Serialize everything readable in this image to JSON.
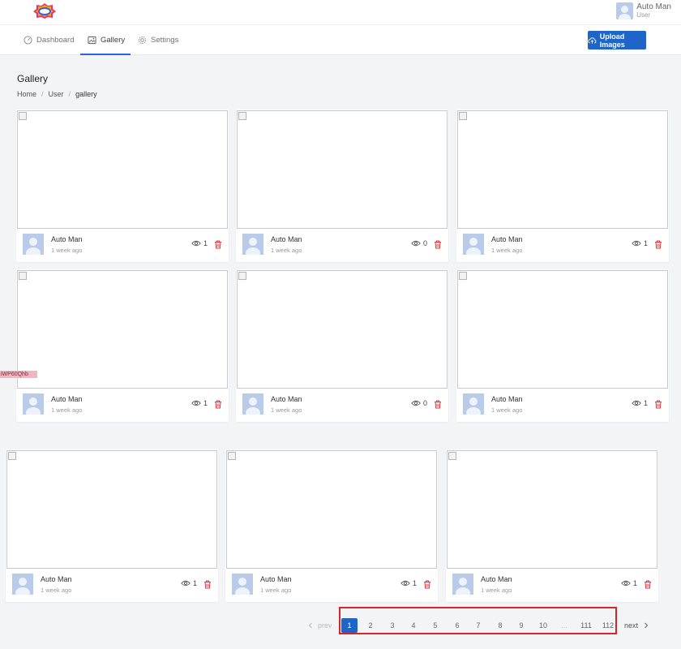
{
  "header": {
    "logo_name": "app-logo",
    "user": {
      "name": "Auto Man",
      "role": "User"
    }
  },
  "nav": {
    "tabs": [
      {
        "label": "Dashboard",
        "icon": "dashboard-icon",
        "active": false
      },
      {
        "label": "Gallery",
        "icon": "image-icon",
        "active": true
      },
      {
        "label": "Settings",
        "icon": "gear-icon",
        "active": false
      }
    ],
    "upload_label": "Upload Images"
  },
  "page": {
    "title": "Gallery",
    "breadcrumb": [
      "Home",
      "User",
      "gallery"
    ]
  },
  "cards": [
    {
      "author": "Auto Man",
      "time": "1 week ago",
      "views": "1"
    },
    {
      "author": "Auto Man",
      "time": "1 week ago",
      "views": "0"
    },
    {
      "author": "Auto Man",
      "time": "1 week ago",
      "views": "1"
    },
    {
      "author": "Auto Man",
      "time": "1 week ago",
      "views": "1"
    },
    {
      "author": "Auto Man",
      "time": "1 week ago",
      "views": "0"
    },
    {
      "author": "Auto Man",
      "time": "1 week ago",
      "views": "1"
    },
    {
      "author": "Auto Man",
      "time": "1 week ago",
      "views": "1"
    },
    {
      "author": "Auto Man",
      "time": "1 week ago",
      "views": "1"
    },
    {
      "author": "Auto Man",
      "time": "1 week ago",
      "views": "1"
    }
  ],
  "overlay_tag": "iWP60Qhb",
  "pagination": {
    "prev": "prev",
    "next": "next",
    "pages": [
      "1",
      "2",
      "3",
      "4",
      "5",
      "6",
      "7",
      "8",
      "9",
      "10",
      "...",
      "111",
      "112"
    ],
    "current": "1"
  },
  "colors": {
    "accent": "#1f65c8",
    "delete": "#d9383c",
    "highlight": "#d7252b"
  }
}
